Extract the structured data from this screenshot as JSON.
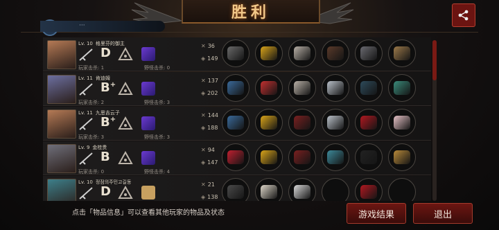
{
  "header": {
    "title": "胜利",
    "colors": {
      "title": "#f2c889",
      "accent_red": "#6b1411"
    }
  },
  "player_strip": {
    "label": "···"
  },
  "players": [
    {
      "level": "Lv. 10",
      "name": "格里芬的御主",
      "grade": "D",
      "grade_plus": "",
      "player_kills": "玩家击杀: 1",
      "monster_kills": "野怪击杀: 0",
      "stat_kills": "36",
      "stat_damage": "149",
      "items": [
        "blade-icon",
        "helmet-icon",
        "armor-icon",
        "bracelet-icon",
        "boots-icon",
        "box-icon"
      ]
    },
    {
      "level": "Lv. 11",
      "name": "肯迪姆",
      "grade": "B",
      "grade_plus": "+",
      "player_kills": "玩家击杀: 2",
      "monster_kills": "野怪击杀: 3",
      "stat_kills": "137",
      "stat_damage": "202",
      "items": [
        "sniper-icon",
        "racing-helmet-icon",
        "armor-icon",
        "feather-icon",
        "gauntlet-icon",
        "gun-accessory-icon"
      ]
    },
    {
      "level": "Lv. 11",
      "name": "九思吉云子",
      "grade": "B",
      "grade_plus": "+",
      "player_kills": "玩家击杀: 3",
      "monster_kills": "野怪击杀: 3",
      "stat_kills": "144",
      "stat_damage": "188",
      "items": [
        "sniper-icon",
        "helmet-icon",
        "cloak-icon",
        "feather-icon",
        "heels-icon",
        "pearl-icon"
      ]
    },
    {
      "level": "Lv. 9",
      "name": "金桂贵",
      "grade": "B",
      "grade_plus": "",
      "player_kills": "玩家击杀: 0",
      "monster_kills": "野怪击杀: 4",
      "stat_kills": "94",
      "stat_damage": "147",
      "items": [
        "red-sword-icon",
        "helmet-icon",
        "cloak-icon",
        "amulet-icon",
        "orb-icon",
        "pumpkin-box-icon"
      ]
    },
    {
      "level": "Lv. 10",
      "name": "정점의주민고길동",
      "grade": "D",
      "grade_plus": "",
      "player_kills": "玩家击杀: 3",
      "monster_kills": "",
      "stat_kills": "21",
      "stat_damage": "138",
      "items": [
        "hat-icon",
        "mask-icon",
        "robe-icon",
        "empty-slot-icon",
        "heels-icon",
        "empty-slot-icon"
      ]
    }
  ],
  "footer": {
    "hint": "点击「物品信息」可以查看其他玩家的物品及状态",
    "result_button": "游戏结果",
    "exit_button": "退出"
  }
}
